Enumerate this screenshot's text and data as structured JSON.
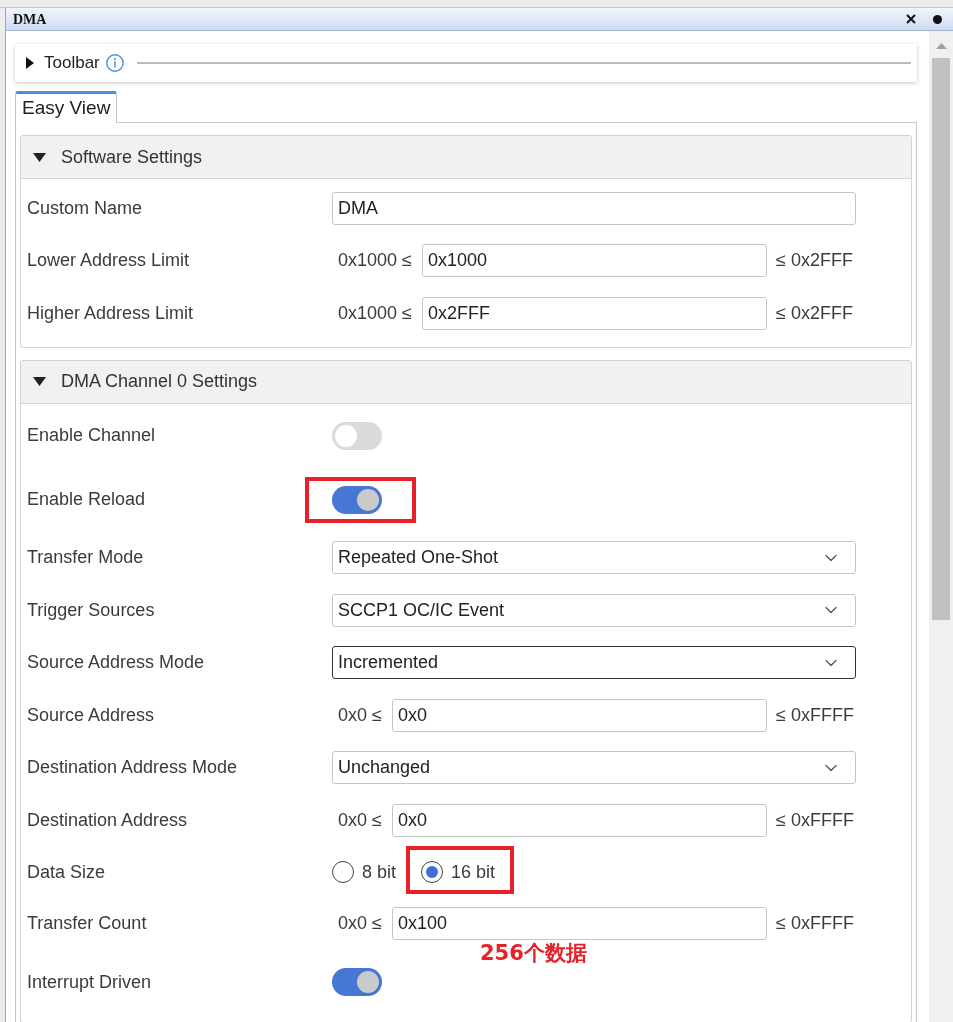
{
  "window": {
    "title": "DMA"
  },
  "toolbar": {
    "label": "Toolbar",
    "expanded": false
  },
  "tabs": [
    {
      "label": "Easy View",
      "selected": true
    }
  ],
  "sections": [
    {
      "title": "Software Settings",
      "expanded": true,
      "rows": [
        {
          "kind": "text",
          "label": "Custom Name",
          "value": "DMA"
        },
        {
          "kind": "range",
          "label": "Lower Address Limit",
          "min": "0x1000 ≤",
          "value": "0x1000",
          "max": "≤ 0x2FFF"
        },
        {
          "kind": "range",
          "label": "Higher Address Limit",
          "min": "0x1000 ≤",
          "value": "0x2FFF",
          "max": "≤ 0x2FFF"
        }
      ]
    },
    {
      "title": "DMA Channel 0 Settings",
      "expanded": true,
      "rows": [
        {
          "kind": "toggle",
          "label": "Enable Channel",
          "on": false,
          "highlighted": false
        },
        {
          "kind": "toggle",
          "label": "Enable Reload",
          "on": true,
          "highlighted": true
        },
        {
          "kind": "select",
          "label": "Transfer Mode",
          "value": "Repeated One-Shot",
          "focused": false
        },
        {
          "kind": "select",
          "label": "Trigger Sources",
          "value": "SCCP1 OC/IC Event",
          "focused": false
        },
        {
          "kind": "select",
          "label": "Source Address Mode",
          "value": "Incremented",
          "focused": true
        },
        {
          "kind": "range",
          "label": "Source Address",
          "min": "0x0 ≤",
          "value": "0x0",
          "max": "≤ 0xFFFF"
        },
        {
          "kind": "select",
          "label": "Destination Address Mode",
          "value": "Unchanged",
          "focused": false
        },
        {
          "kind": "range",
          "label": "Destination Address",
          "min": "0x0 ≤",
          "value": "0x0",
          "max": "≤ 0xFFFF"
        },
        {
          "kind": "radio",
          "label": "Data Size",
          "options": [
            {
              "label": "8 bit",
              "selected": false,
              "highlighted": false
            },
            {
              "label": "16 bit",
              "selected": true,
              "highlighted": true
            }
          ]
        },
        {
          "kind": "range",
          "label": "Transfer Count",
          "min": "0x0 ≤",
          "value": "0x100",
          "max": "≤ 0xFFFF",
          "note": "256个数据"
        },
        {
          "kind": "toggle",
          "label": "Interrupt Driven",
          "on": true,
          "highlighted": false
        }
      ]
    }
  ]
}
